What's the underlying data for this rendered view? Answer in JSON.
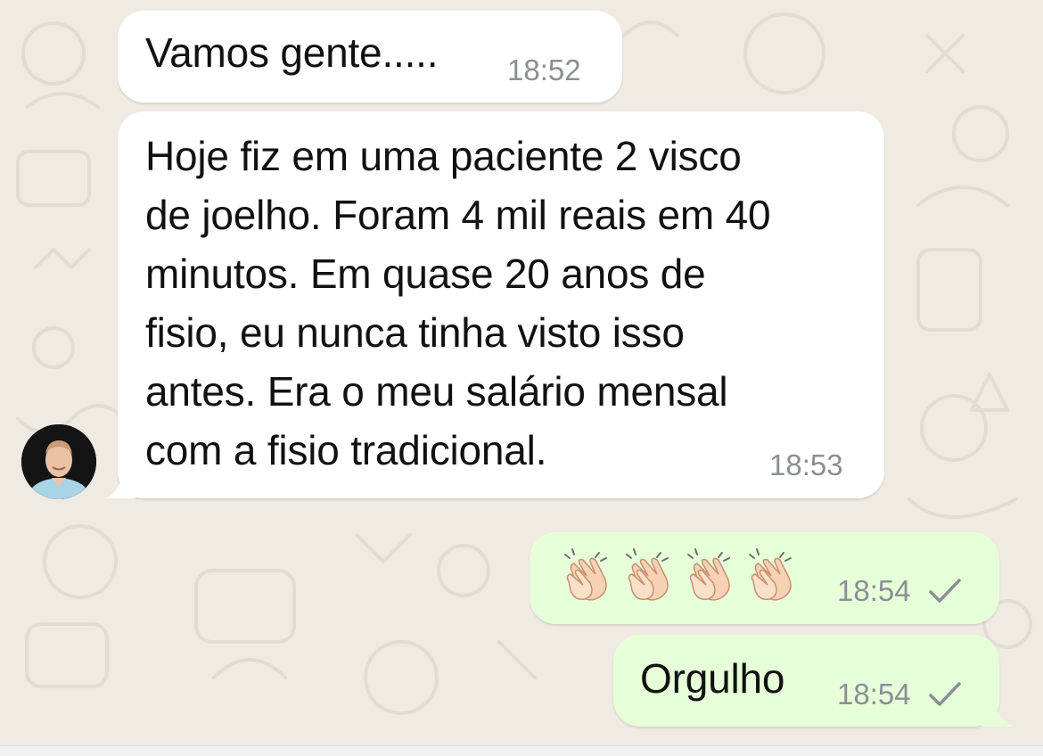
{
  "messages": [
    {
      "direction": "incoming",
      "text": "Vamos gente.....",
      "time": "18:52"
    },
    {
      "direction": "incoming",
      "text": "Hoje fiz em uma paciente 2 visco\nde joelho. Foram 4 mil reais em 40\nminutos. Em quase 20 anos de\nfisio, eu nunca tinha visto isso\nantes. Era o meu salário mensal\ncom a fisio tradicional.",
      "time": "18:53"
    },
    {
      "direction": "outgoing",
      "emoji_icons": [
        "clapping-hands-icon",
        "clapping-hands-icon",
        "clapping-hands-icon",
        "clapping-hands-icon"
      ],
      "time": "18:54",
      "status_icon": "single-check-icon"
    },
    {
      "direction": "outgoing",
      "text": "Orgulho",
      "time": "18:54",
      "status_icon": "single-check-icon"
    }
  ],
  "colors": {
    "chat_background": "#efeae2",
    "incoming_bubble": "#ffffff",
    "outgoing_bubble": "#e7ffd9",
    "timestamp": "#8a8f93"
  }
}
